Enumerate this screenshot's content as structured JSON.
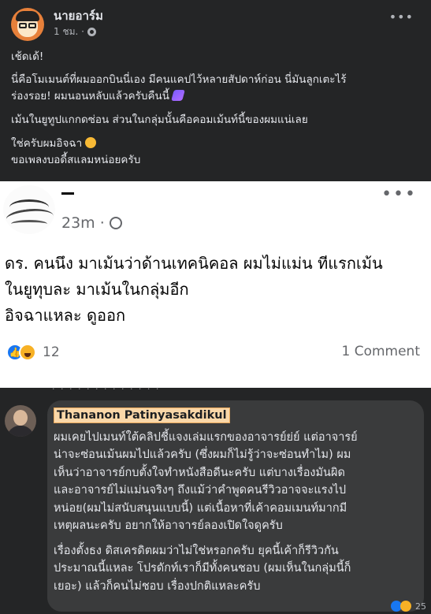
{
  "top_post": {
    "author": "นายอาร์ม",
    "time": "1 ชม. ·",
    "lines": [
      "เช้ดเด้!",
      "นี่คือโมเมนต์ที่ผมออกบินนี่เอง มีคนแคปไว้หลายสัปดาห์ก่อน นี่มันลูกเตะไร้",
      "ร่องรอย! ผมนอนหลับแล้วครับคืนนี้",
      "เม้นในยูทูปแกกดซ่อน ส่วนในกลุ่มนั้นคือคอมเม้นท์นี้ของผมแน่เลย",
      "ใช่ครับผมอิจฉา",
      "ขอเพลงบอดี้สแลมหน่อยครับ"
    ]
  },
  "mid_post": {
    "time": "23m ·",
    "lines": [
      "ดร. คนนึง มาเม้นว่าด้านเทคนิคอล ผมไม่แม่น ทีแรกเม้น",
      "ในยูทุบละ มาเม้นในกลุ่มอีก",
      "อิจฉาแหละ ดูออก"
    ],
    "reaction_count": "12",
    "comment_count": "1 Comment"
  },
  "comment": {
    "name": "Thananon Patinyasakdikul",
    "lines": [
      "ผมเคยไปเมนท์ใต้คลิปชี้แจงเล่มแรกของอาจารย์ย่ย์ แต่อาจารย์",
      "น่าจะซ่อนเม้นผมไปแล้วครับ (ซึ่งผมก็ไม่รู้ว่าจะซ่อนทำไม) ผม",
      "เห็นว่าอาจารย์กบตั้งใจทำหนังสือดีนะครับ แต่บางเรื่องมันผิด",
      "และอาจารย์ไม่แม่นจริงๆ ถึงแม้ว่าคำพูดคนรีวิวอาจจะแรงไป",
      "หน่อย(ผมไม่สนับสนุนแบบนี้) แต่เนื้อหาที่เค้าคอมเมนท์มากมี",
      "เหตุผลนะครับ อยากให้อาจารย์ลองเปิดใจดูครับ",
      "เรื่องตั้งธง ดิสเครดิตผมว่าไม่ใช่หรอกครับ ยุคนี้เค้าก็รีวิวกัน",
      "ประมาณนี้แหละ โปรดักท์เราก็มีทั้งคนชอบ (ผมเห็นในกลุ่มนี้ก็",
      "เยอะ) แล้วก็คนไม่ชอบ เรื่องปกติแหละครับ"
    ],
    "reaction_count": "25"
  },
  "icons": {
    "globe": "globe-icon",
    "more": "more-dots-icon",
    "sleep": "zzz-emoji",
    "cry": "crying-emoji",
    "like": "like-reaction-icon",
    "haha": "haha-reaction-icon"
  },
  "colors": {
    "dark_bg": "#242526",
    "bubble_bg": "#3a3b3c",
    "facebook_blue": "#1877f2",
    "highlight": "#fad7a8"
  }
}
